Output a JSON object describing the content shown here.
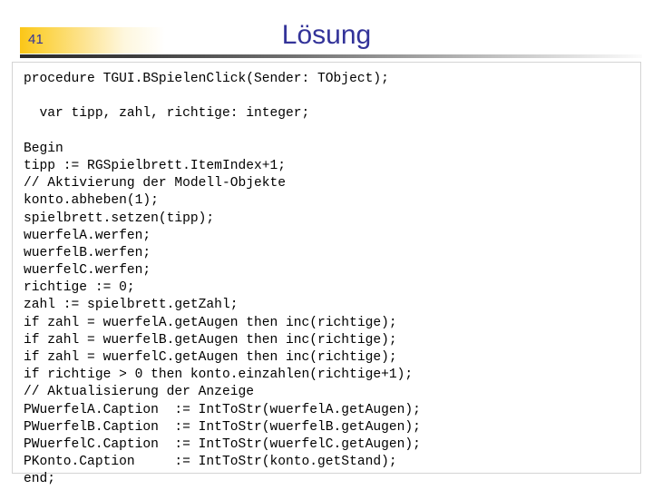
{
  "slide": {
    "page_number": "41",
    "title": "Lösung",
    "title_color": "#333399",
    "badge_color_start": "#fbc617",
    "badge_color_end": "#ffffff",
    "rule_color_start": "#2b2b2b",
    "rule_color_end": "#fbfbfb"
  },
  "code": {
    "language": "pascal",
    "lines": [
      "procedure TGUI.BSpielenClick(Sender: TObject);",
      "",
      "  var tipp, zahl, richtige: integer;",
      "",
      "Begin",
      "tipp := RGSpielbrett.ItemIndex+1;",
      "// Aktivierung der Modell-Objekte",
      "konto.abheben(1);",
      "spielbrett.setzen(tipp);",
      "wuerfelA.werfen;",
      "wuerfelB.werfen;",
      "wuerfelC.werfen;",
      "richtige := 0;",
      "zahl := spielbrett.getZahl;",
      "if zahl = wuerfelA.getAugen then inc(richtige);",
      "if zahl = wuerfelB.getAugen then inc(richtige);",
      "if zahl = wuerfelC.getAugen then inc(richtige);",
      "if richtige > 0 then konto.einzahlen(richtige+1);",
      "// Aktualisierung der Anzeige",
      "PWuerfelA.Caption  := IntToStr(wuerfelA.getAugen);",
      "PWuerfelB.Caption  := IntToStr(wuerfelB.getAugen);",
      "PWuerfelC.Caption  := IntToStr(wuerfelC.getAugen);",
      "PKonto.Caption     := IntToStr(konto.getStand);",
      "end;"
    ]
  }
}
